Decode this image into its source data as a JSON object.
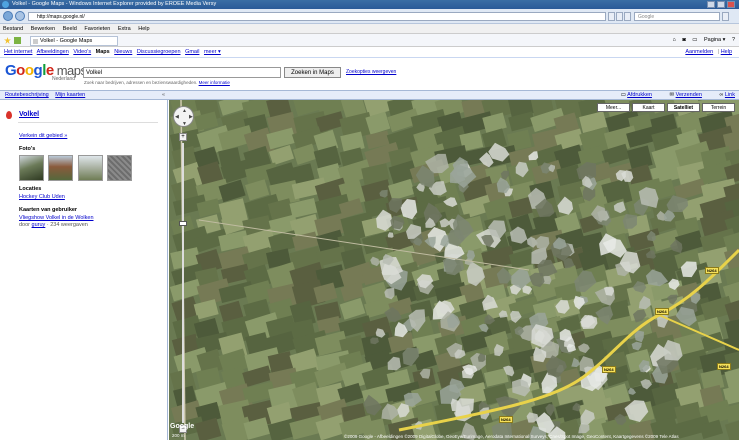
{
  "window": {
    "title": "Volkel - Google Maps - Windows Internet Explorer provided by EROEE Media Versy"
  },
  "browser": {
    "url": "http://maps.google.nl/",
    "search_placeholder": "Google",
    "menu": [
      "Bestand",
      "Bewerken",
      "Beeld",
      "Favorieten",
      "Extra",
      "Help"
    ],
    "tab_title": "Volkel - Google Maps",
    "commands": [
      "Pagina ▾"
    ]
  },
  "google_nav": {
    "links": [
      "Het internet",
      "Afbeeldingen",
      "Video's"
    ],
    "active": "Maps",
    "links2": [
      "Nieuws",
      "Discussiegroepen",
      "Gmail",
      "meer ▾"
    ],
    "right": [
      "Aanmelden",
      "Help"
    ]
  },
  "header": {
    "logo": "Google",
    "logo_suffix": "maps",
    "logo_sub": "Nederland",
    "query": "Volkel",
    "hint": "Zoek naar bedrijven, adressen en bezienswaardigheden.",
    "hint_link": "Meer informatie",
    "search_button": "Zoeken in Maps",
    "options_link": "Zoekopties weergeven"
  },
  "toolbar": {
    "left": [
      "Routebeschrijving",
      "Mijn kaarten"
    ],
    "collapse": "«",
    "right": [
      "Afdrukken",
      "Verzenden",
      "Link"
    ]
  },
  "panel": {
    "title": "Volkel",
    "zoom_link": "Verkein dit gebied »",
    "photos_label": "Foto's",
    "locations_label": "Locaties",
    "location_link": "Hockey Club Uden",
    "user_maps_label": "Kaarten van gebruiker",
    "user_map_link": "Vliegshow Volkel in de Wolken",
    "user_map_meta_prefix": "door",
    "user_map_author": "guruy",
    "user_map_meta_suffix": "· 234 weergaven"
  },
  "map": {
    "types": [
      "Meer...",
      "Kaart",
      "Satelliet",
      "Terrein"
    ],
    "selected_type": "Satelliet",
    "pan_labels": {
      "n": "▲",
      "s": "▼",
      "w": "◀",
      "e": "▶"
    },
    "zoom_in": "+",
    "zoom_out": "−",
    "road_labels": [
      "N264",
      "N264",
      "N264",
      "N264",
      "N264"
    ],
    "scale": "200 m",
    "copyright": "©2009 Google - Afbeeldingen ©2009 DigitalGlobe, GeoEye/Eurimage, Aerodata International Surveys, Cnes/Spot Image, GeoContent, Kaartgegevens ©2009 Tele Atlas",
    "google_watermark": "Google"
  },
  "colors": {
    "link": "#0000cc",
    "strip_bg": "#e5ecf9",
    "field_dark": "#4d5a3a",
    "field_light": "#8a9a6a",
    "road": "#e8d24a"
  }
}
